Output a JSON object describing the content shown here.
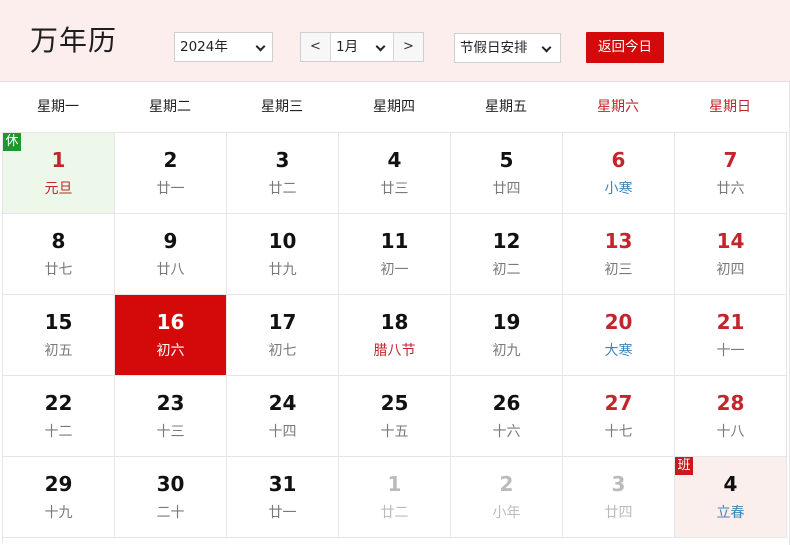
{
  "title": "万年历",
  "controls": {
    "year": "2024年",
    "prev": "<",
    "month": "1月",
    "next": ">",
    "holiday": "节假日安排",
    "today_button": "返回今日"
  },
  "weekdays": [
    "星期一",
    "星期二",
    "星期三",
    "星期四",
    "星期五",
    "星期六",
    "星期日"
  ],
  "colors": {
    "accent_red": "#d40a0a",
    "weekend_red": "#c0262b",
    "solar_term_blue": "#3f85b6",
    "rest_badge_green": "#1b9a2b",
    "rest_day_bg": "#eef8ea",
    "work_day_bg": "#fbefee",
    "header_bg": "#fbeeec"
  },
  "days": [
    {
      "d": "1",
      "l": "元旦",
      "cls": "hol fest",
      "badge": "休"
    },
    {
      "d": "2",
      "l": "廿一",
      "cls": ""
    },
    {
      "d": "3",
      "l": "廿二",
      "cls": ""
    },
    {
      "d": "4",
      "l": "廿三",
      "cls": ""
    },
    {
      "d": "5",
      "l": "廿四",
      "cls": ""
    },
    {
      "d": "6",
      "l": "小寒",
      "cls": "we term"
    },
    {
      "d": "7",
      "l": "廿六",
      "cls": "we"
    },
    {
      "d": "8",
      "l": "廿七",
      "cls": ""
    },
    {
      "d": "9",
      "l": "廿八",
      "cls": ""
    },
    {
      "d": "10",
      "l": "廿九",
      "cls": ""
    },
    {
      "d": "11",
      "l": "初一",
      "cls": ""
    },
    {
      "d": "12",
      "l": "初二",
      "cls": ""
    },
    {
      "d": "13",
      "l": "初三",
      "cls": "we"
    },
    {
      "d": "14",
      "l": "初四",
      "cls": "we"
    },
    {
      "d": "15",
      "l": "初五",
      "cls": ""
    },
    {
      "d": "16",
      "l": "初六",
      "cls": "sel-day"
    },
    {
      "d": "17",
      "l": "初七",
      "cls": ""
    },
    {
      "d": "18",
      "l": "腊八节",
      "cls": "fest"
    },
    {
      "d": "19",
      "l": "初九",
      "cls": ""
    },
    {
      "d": "20",
      "l": "大寒",
      "cls": "we term"
    },
    {
      "d": "21",
      "l": "十一",
      "cls": "we"
    },
    {
      "d": "22",
      "l": "十二",
      "cls": ""
    },
    {
      "d": "23",
      "l": "十三",
      "cls": ""
    },
    {
      "d": "24",
      "l": "十四",
      "cls": ""
    },
    {
      "d": "25",
      "l": "十五",
      "cls": ""
    },
    {
      "d": "26",
      "l": "十六",
      "cls": ""
    },
    {
      "d": "27",
      "l": "十七",
      "cls": "we"
    },
    {
      "d": "28",
      "l": "十八",
      "cls": "we"
    },
    {
      "d": "29",
      "l": "十九",
      "cls": ""
    },
    {
      "d": "30",
      "l": "二十",
      "cls": ""
    },
    {
      "d": "31",
      "l": "廿一",
      "cls": ""
    },
    {
      "d": "1",
      "l": "廿二",
      "cls": "other"
    },
    {
      "d": "2",
      "l": "小年",
      "cls": "other"
    },
    {
      "d": "3",
      "l": "廿四",
      "cls": "other"
    },
    {
      "d": "4",
      "l": "立春",
      "cls": "work term",
      "badge": "班"
    }
  ]
}
